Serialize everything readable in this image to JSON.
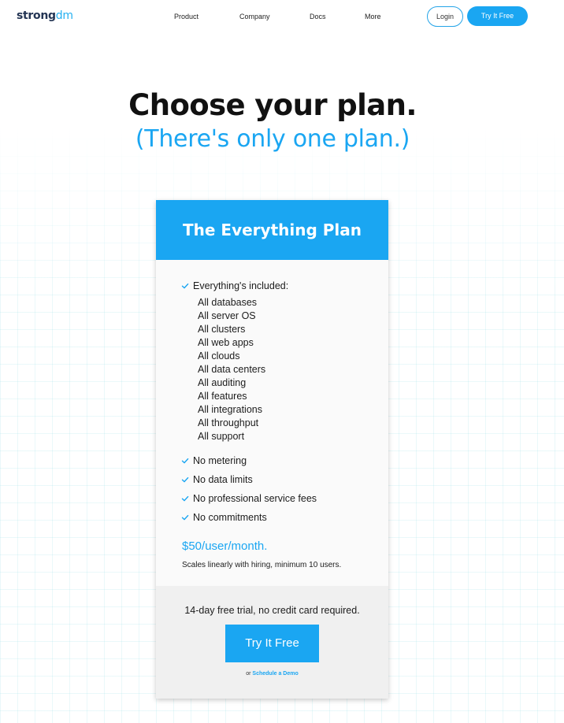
{
  "brand": {
    "logo_part1": "strong",
    "logo_part2": "dm",
    "accent_color": "#1aa6f2",
    "logo_dark_color": "#243554"
  },
  "nav": {
    "items": [
      "Product",
      "Company",
      "Docs",
      "More"
    ],
    "login_label": "Login",
    "try_label": "Try It Free"
  },
  "hero": {
    "title": "Choose your plan.",
    "subtitle": "(There's only one plan.)"
  },
  "plan": {
    "name": "The Everything Plan",
    "everything_label": "Everything's included:",
    "included": [
      "All databases",
      "All server OS",
      "All clusters",
      "All web apps",
      "All clouds",
      "All data centers",
      "All auditing",
      "All features",
      "All integrations",
      "All throughput",
      "All support"
    ],
    "perks": [
      "No metering",
      "No data limits",
      "No professional service fees",
      "No commitments"
    ],
    "price": "$50/user/month.",
    "price_note": "Scales linearly with hiring, minimum 10 users.",
    "trial_note": "14-day free trial, no credit card required.",
    "cta_label": "Try It Free",
    "or_label": "or",
    "demo_label": "Schedule a Demo",
    "check_icon": "check-icon"
  }
}
